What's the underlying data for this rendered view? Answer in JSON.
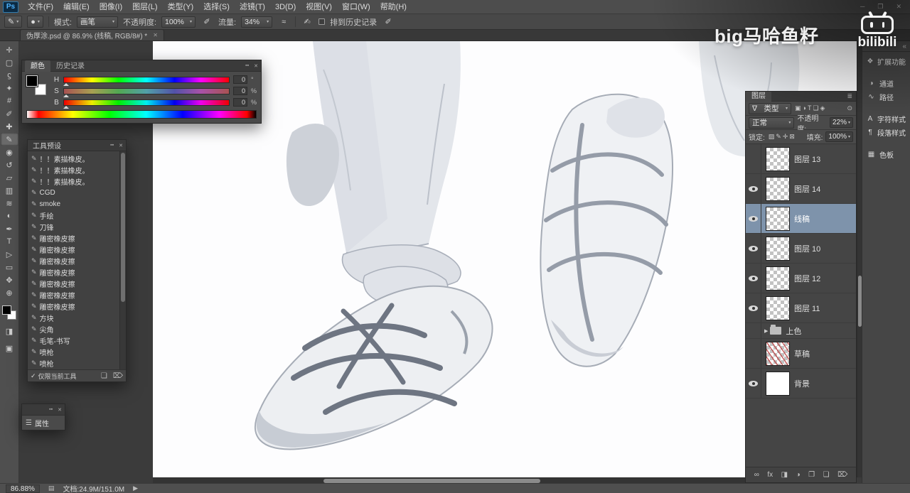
{
  "ui": {
    "caret": "▾",
    "panel_menu": "▪▪",
    "panel_close": "✕"
  },
  "window": {
    "logo": "Ps",
    "controls": [
      {
        "name": "minimize-button",
        "glyph": "─"
      },
      {
        "name": "maximize-button",
        "glyph": "❐"
      },
      {
        "name": "close-button",
        "glyph": "✕"
      }
    ]
  },
  "menubar": {
    "items": [
      "文件(F)",
      "编辑(E)",
      "图像(I)",
      "图层(L)",
      "类型(Y)",
      "选择(S)",
      "滤镜(T)",
      "3D(D)",
      "视图(V)",
      "窗口(W)",
      "帮助(H)"
    ]
  },
  "options_bar": {
    "tool_icon": "✎",
    "preset_glyph": "●",
    "mode_label": "模式:",
    "mode_value": "画笔",
    "opacity_label": "不透明度:",
    "opacity_value": "100%",
    "pressure_icon": "✐",
    "flow_label": "流量:",
    "flow_value": "34%",
    "airbrush_icon": "≈",
    "history_label": "排到历史记录",
    "history_icon": "✍"
  },
  "document_tab": {
    "title": "伪厚涂.psd @ 86.9% (线稿, RGB/8#) *",
    "close_glyph": "✕"
  },
  "toolbar": {
    "tools": [
      {
        "name": "move",
        "glyph": "✛"
      },
      {
        "name": "marquee",
        "glyph": "▢"
      },
      {
        "name": "lasso",
        "glyph": "ϛ"
      },
      {
        "name": "quick-selection",
        "glyph": "✦"
      },
      {
        "name": "crop",
        "glyph": "#"
      },
      {
        "name": "eyedropper",
        "glyph": "✐"
      },
      {
        "name": "healing-brush",
        "glyph": "✚"
      },
      {
        "name": "brush",
        "glyph": "✎",
        "selected": true
      },
      {
        "name": "clone-stamp",
        "glyph": "◉"
      },
      {
        "name": "history-brush",
        "glyph": "↺"
      },
      {
        "name": "eraser",
        "glyph": "▱"
      },
      {
        "name": "gradient",
        "glyph": "▥"
      },
      {
        "name": "smudge",
        "glyph": "≋"
      },
      {
        "name": "dodge",
        "glyph": "◐"
      },
      {
        "name": "pen",
        "glyph": "✒"
      },
      {
        "name": "type",
        "glyph": "T"
      },
      {
        "name": "path-selection",
        "glyph": "▷"
      },
      {
        "name": "shape",
        "glyph": "▭"
      },
      {
        "name": "hand",
        "glyph": "✥"
      },
      {
        "name": "zoom",
        "glyph": "⊕"
      }
    ],
    "extras": [
      {
        "name": "quick-mask",
        "glyph": "◨"
      },
      {
        "name": "screen-mode",
        "glyph": "▣"
      }
    ]
  },
  "color_panel": {
    "tabs": [
      {
        "label": "颜色",
        "active": true
      },
      {
        "label": "历史记录",
        "active": false
      }
    ],
    "sliders": [
      {
        "channel": "H",
        "value": "0",
        "unit": "°"
      },
      {
        "channel": "S",
        "value": "0",
        "unit": "%"
      },
      {
        "channel": "B",
        "value": "0",
        "unit": "%"
      }
    ]
  },
  "tool_presets": {
    "title": "工具预设",
    "item_icon": "✎",
    "items": [
      "！！素描橡皮。",
      "！！素描橡皮。",
      "！！素描橡皮。",
      "CGD",
      "smoke",
      "手绘",
      "刀锋",
      "雕密橡皮擦",
      "雕密橡皮擦",
      "雕密橡皮擦",
      "雕密橡皮擦",
      "雕密橡皮擦",
      "雕密橡皮擦",
      "雕密橡皮擦",
      "方块",
      "尖角",
      "毛笔-书写",
      "喷枪",
      "喷枪"
    ],
    "footer": {
      "check_glyph": "✓",
      "label": "仅限当前工具",
      "icons": [
        {
          "name": "new-tool-preset",
          "glyph": "❏"
        },
        {
          "name": "delete-tool-preset",
          "glyph": "⌦"
        }
      ]
    }
  },
  "properties_panel": {
    "icon": "☰",
    "label": "属性"
  },
  "layers_panel": {
    "tab": "图层",
    "menu_glyph": "≣",
    "filter": {
      "icon": "∇",
      "label": "类型",
      "icons": [
        {
          "name": "filter-pixel-layers",
          "glyph": "▣"
        },
        {
          "name": "filter-adjustment-layers",
          "glyph": "◑"
        },
        {
          "name": "filter-type-layers",
          "glyph": "T"
        },
        {
          "name": "filter-shape-layers",
          "glyph": "❏"
        },
        {
          "name": "filter-smart-objects",
          "glyph": "◈"
        }
      ],
      "toggle_glyph": "⊙"
    },
    "blend_mode": "正常",
    "opacity_label": "不透明度:",
    "opacity_value": "22%",
    "lock_label": "锁定:",
    "lock_icons": [
      {
        "name": "lock-transparency",
        "glyph": "▨"
      },
      {
        "name": "lock-pixels",
        "glyph": "✎"
      },
      {
        "name": "lock-position",
        "glyph": "✛"
      },
      {
        "name": "lock-all",
        "glyph": "⊠"
      }
    ],
    "fill_label": "填充:",
    "fill_value": "100%",
    "layers": [
      {
        "name": "图层 13",
        "eye": false,
        "thumb": "checker"
      },
      {
        "name": "图层 14",
        "eye": true,
        "thumb": "checker"
      },
      {
        "name": "线稿",
        "eye": true,
        "thumb": "checker",
        "selected": true
      },
      {
        "name": "图层 10",
        "eye": true,
        "thumb": "checker"
      },
      {
        "name": "图层 12",
        "eye": true,
        "thumb": "checker"
      },
      {
        "name": "图层 11",
        "eye": true,
        "thumb": "checker"
      },
      {
        "name": "上色",
        "eye": false,
        "group": true,
        "disclosure": "▶"
      },
      {
        "name": "草稿",
        "eye": false,
        "thumb": "sketch"
      },
      {
        "name": "背景",
        "eye": true,
        "thumb": "white"
      }
    ],
    "bottom_icons": [
      {
        "name": "link-layers",
        "glyph": "∞"
      },
      {
        "name": "layer-style",
        "glyph": "fx"
      },
      {
        "name": "add-layer-mask",
        "glyph": "◨"
      },
      {
        "name": "adjustment-layer",
        "glyph": "◑"
      },
      {
        "name": "new-group",
        "glyph": "❐"
      },
      {
        "name": "new-layer",
        "glyph": "❏"
      },
      {
        "name": "delete-layer",
        "glyph": "⌦"
      }
    ]
  },
  "dock": {
    "collapse_glyph": "«",
    "groups": [
      [
        {
          "name": "extensions",
          "icon": "❖",
          "label": "扩展功能"
        }
      ],
      [
        {
          "name": "channels",
          "icon": "◑",
          "label": "通道"
        },
        {
          "name": "paths",
          "icon": "∿",
          "label": "路径"
        }
      ],
      [
        {
          "name": "character-styles",
          "icon": "A",
          "label": "字符样式"
        },
        {
          "name": "paragraph-styles",
          "icon": "¶",
          "label": "段落样式"
        }
      ],
      [
        {
          "name": "swatches",
          "icon": "▦",
          "label": "色板"
        }
      ]
    ]
  },
  "status_bar": {
    "zoom": "86.88%",
    "icon": "▤",
    "doc_info": "文档:24.9M/151.0M",
    "arrow": "▶"
  },
  "watermarks": {
    "uploader": "big马哈鱼籽",
    "site": "bilibili"
  },
  "colors": {
    "chrome": "#4d4d4d",
    "pasteboard": "#3b3b3b",
    "selected_layer": "#7e93ab",
    "logo_blue": "#4db3ff"
  }
}
